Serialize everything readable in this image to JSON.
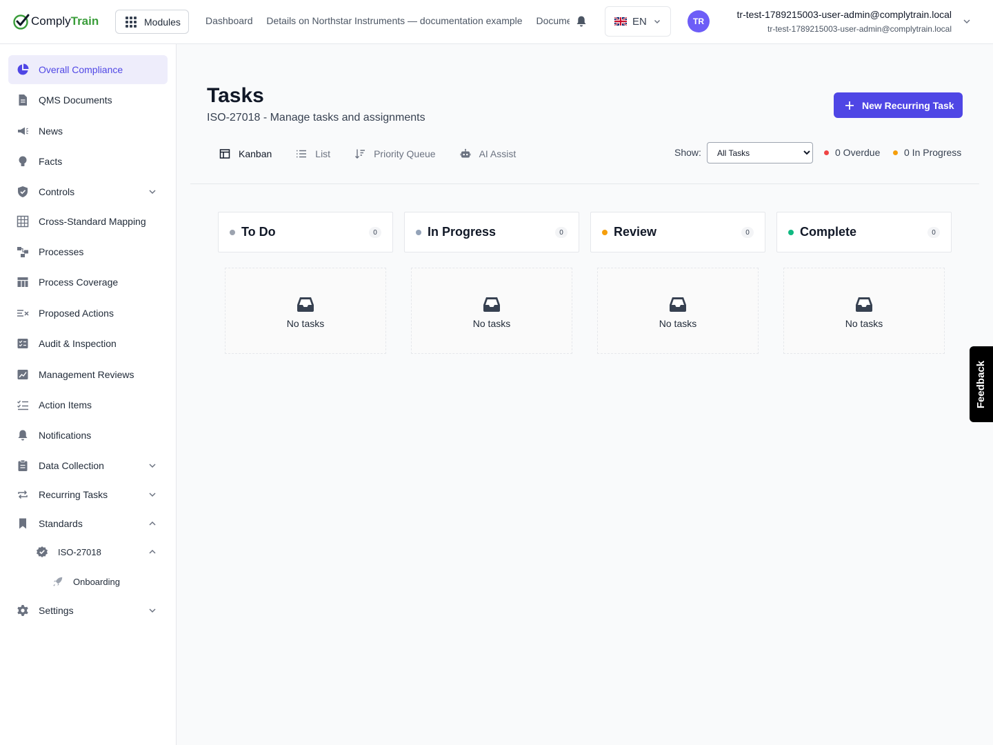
{
  "header": {
    "logo": {
      "comply": "Comply",
      "train": "Train"
    },
    "modules_label": "Modules",
    "breadcrumbs": [
      "Dashboard",
      "Details on Northstar Instruments — documentation example",
      "Documents"
    ],
    "language": "EN",
    "avatar_initials": "TR",
    "user_name": "tr-test-1789215003-user-admin@complytrain.local",
    "user_email": "tr-test-1789215003-user-admin@complytrain.local"
  },
  "sidebar": {
    "items": [
      {
        "label": "Overall Compliance",
        "icon": "pie-chart-icon"
      },
      {
        "label": "QMS Documents",
        "icon": "document-icon"
      },
      {
        "label": "News",
        "icon": "megaphone-icon"
      },
      {
        "label": "Facts",
        "icon": "lightbulb-icon"
      },
      {
        "label": "Controls",
        "icon": "shield-icon"
      },
      {
        "label": "Cross-Standard Mapping",
        "icon": "table-grid-icon"
      },
      {
        "label": "Processes",
        "icon": "process-flow-icon"
      },
      {
        "label": "Process Coverage",
        "icon": "table-icon"
      },
      {
        "label": "Proposed Actions",
        "icon": "list-x-icon"
      },
      {
        "label": "Audit & Inspection",
        "icon": "checklist-icon"
      },
      {
        "label": "Management Reviews",
        "icon": "chart-review-icon"
      },
      {
        "label": "Action Items",
        "icon": "list-check-icon"
      },
      {
        "label": "Notifications",
        "icon": "bell-icon"
      },
      {
        "label": "Data Collection",
        "icon": "clipboard-icon"
      },
      {
        "label": "Recurring Tasks",
        "icon": "repeat-icon"
      },
      {
        "label": "Standards",
        "icon": "bookmark-icon"
      },
      {
        "label": "ISO-27018",
        "icon": "badge-check-icon"
      },
      {
        "label": "Onboarding",
        "icon": "rocket-icon"
      },
      {
        "label": "Settings",
        "icon": "gear-icon"
      }
    ]
  },
  "main": {
    "title": "Tasks",
    "subtitle": "ISO-27018 - Manage tasks and assignments",
    "new_button": "New Recurring Task",
    "tabs": [
      "Kanban",
      "List",
      "Priority Queue",
      "AI Assist"
    ],
    "active_tab": "Kanban",
    "show_label": "Show:",
    "show_options": [
      "All Tasks"
    ],
    "show_selected": "All Tasks",
    "overdue": "0 Overdue",
    "in_progress": "0 In Progress",
    "columns": [
      {
        "title": "To Do",
        "count": "0",
        "color": "#9ca3af",
        "empty": "No tasks"
      },
      {
        "title": "In Progress",
        "count": "0",
        "color": "#94a3b8",
        "empty": "No tasks"
      },
      {
        "title": "Review",
        "count": "0",
        "color": "#f59e0b",
        "empty": "No tasks"
      },
      {
        "title": "Complete",
        "count": "0",
        "color": "#10b981",
        "empty": "No tasks"
      }
    ]
  },
  "feedback": "Feedback",
  "colors": {
    "accent": "#4f46e5",
    "overdue": "#ef4444",
    "in_progress": "#f59e0b",
    "brand_green": "#3a9d3a"
  }
}
